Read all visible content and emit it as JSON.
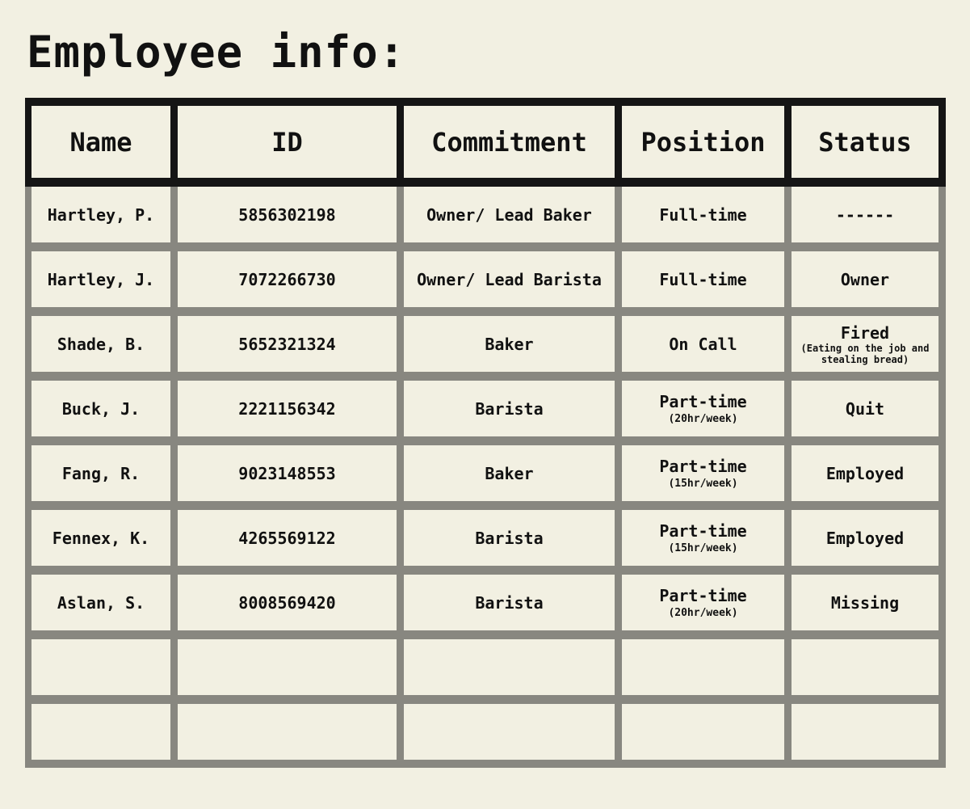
{
  "title": "Employee info:",
  "table": {
    "headers": [
      "Name",
      "ID",
      "Commitment",
      "Position",
      "Status"
    ],
    "rows": [
      {
        "name": "Hartley, P.",
        "id": "5856302198",
        "commitment": "Owner/ Lead Baker",
        "position": "Full-time",
        "position_sub": "",
        "status": "------",
        "status_note": ""
      },
      {
        "name": "Hartley, J.",
        "id": "7072266730",
        "commitment": "Owner/ Lead Barista",
        "position": "Full-time",
        "position_sub": "",
        "status": "Owner",
        "status_note": ""
      },
      {
        "name": "Shade, B.",
        "id": "5652321324",
        "commitment": "Baker",
        "position": "On Call",
        "position_sub": "",
        "status": "Fired",
        "status_note": "(Eating on the job and stealing bread)"
      },
      {
        "name": "Buck, J.",
        "id": "2221156342",
        "commitment": "Barista",
        "position": "Part-time",
        "position_sub": "(20hr/week)",
        "status": "Quit",
        "status_note": ""
      },
      {
        "name": "Fang, R.",
        "id": "9023148553",
        "commitment": "Baker",
        "position": "Part-time",
        "position_sub": "(15hr/week)",
        "status": "Employed",
        "status_note": ""
      },
      {
        "name": "Fennex, K.",
        "id": "4265569122",
        "commitment": "Barista",
        "position": "Part-time",
        "position_sub": "(15hr/week)",
        "status": "Employed",
        "status_note": ""
      },
      {
        "name": "Aslan, S.",
        "id": "8008569420",
        "commitment": "Barista",
        "position": "Part-time",
        "position_sub": "(20hr/week)",
        "status": "Missing",
        "status_note": ""
      },
      {
        "name": "",
        "id": "",
        "commitment": "",
        "position": "",
        "position_sub": "",
        "status": "",
        "status_note": ""
      },
      {
        "name": "",
        "id": "",
        "commitment": "",
        "position": "",
        "position_sub": "",
        "status": "",
        "status_note": ""
      }
    ]
  },
  "colors": {
    "background": "#f2f0e2",
    "header_border": "#151515",
    "row_border": "#888780",
    "text": "#111111"
  }
}
